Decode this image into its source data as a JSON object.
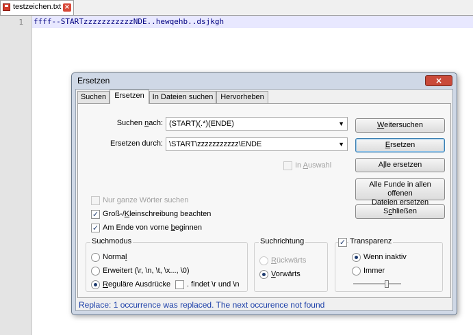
{
  "file_tab": {
    "name": "testzeichen.txt"
  },
  "editor": {
    "line_number": "1",
    "line_text": "ffff--STARTzzzzzzzzzzzNDE..hewqehb..dsjkgh"
  },
  "dialog": {
    "title": "Ersetzen",
    "tabs": [
      "Suchen",
      "Ersetzen",
      "In Dateien suchen",
      "Hervorheben"
    ],
    "active_tab": "Ersetzen",
    "find_label": "Suchen nach:",
    "find_value": "(START)(.*)(ENDE)",
    "replace_label": "Ersetzen durch:",
    "replace_value": "\\START\\zzzzzzzzzzz\\ENDE",
    "in_selection": {
      "label": "In Auswahl",
      "checked": false,
      "enabled": false
    },
    "buttons": {
      "find_next": "Weitersuchen",
      "replace": "Ersetzen",
      "replace_all": "Alle ersetzen",
      "replace_all_open_line1": "Alle Funde in allen offenen",
      "replace_all_open_line2": "Dateien ersetzen",
      "close": "Schließen"
    },
    "options": {
      "whole_word": {
        "label": "Nur ganze Wörter suchen",
        "checked": false,
        "enabled": false
      },
      "match_case": {
        "label": "Groß-/Kleinschreibung beachten",
        "checked": true
      },
      "wrap_around": {
        "label": "Am Ende von vorne beginnen",
        "checked": true
      }
    },
    "search_mode": {
      "title": "Suchmodus",
      "normal": "Normal",
      "extended": "Erweitert (\\r, \\n, \\t, \\x..., \\0)",
      "regex": "Reguläre Ausdrücke",
      "dot_matches_newline": ". findet \\r und \\n",
      "selected": "regex"
    },
    "direction": {
      "title": "Suchrichtung",
      "backward": "Rückwärts",
      "forward": "Vorwärts",
      "selected": "forward"
    },
    "transparency": {
      "title": "Transparenz",
      "checked": true,
      "on_lose_focus": "Wenn inaktiv",
      "always": "Immer",
      "selected": "on_lose_focus"
    },
    "status_text": "Replace: 1 occurrence was replaced. The next occurence not found"
  }
}
